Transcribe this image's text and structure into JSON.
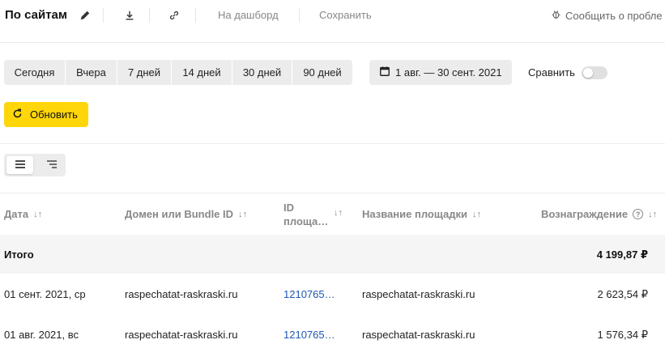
{
  "header": {
    "title": "По сайтам",
    "dashboard_label": "На дашборд",
    "save_label": "Сохранить",
    "report_label": "Сообщить о пробле"
  },
  "periods": [
    "Сегодня",
    "Вчера",
    "7 дней",
    "14 дней",
    "30 дней",
    "90 дней"
  ],
  "date_range": "1 авг. — 30 сент. 2021",
  "compare": {
    "label": "Сравнить",
    "enabled": false
  },
  "refresh_label": "Обновить",
  "table": {
    "headers": {
      "date": "Дата",
      "domain": "Домен или Bundle ID",
      "id_line1": "ID",
      "id_line2": "площа…",
      "name": "Название площадки",
      "reward": "Вознаграждение"
    },
    "sort_glyph": "↓↑",
    "help_glyph": "?",
    "total": {
      "label": "Итого",
      "reward": "4 199,87 ₽"
    },
    "rows": [
      {
        "date": "01 сент. 2021, ср",
        "domain": "raspechatat-raskraski.ru",
        "id": "1210765…",
        "name": "raspechatat-raskraski.ru",
        "reward": "2 623,54 ₽"
      },
      {
        "date": "01 авг. 2021, вс",
        "domain": "raspechatat-raskraski.ru",
        "id": "1210765…",
        "name": "raspechatat-raskraski.ru",
        "reward": "1 576,34 ₽"
      }
    ]
  },
  "colors": {
    "accent_yellow": "#ffd60a",
    "link_blue": "#1f57b5",
    "button_gray": "#ececec"
  }
}
